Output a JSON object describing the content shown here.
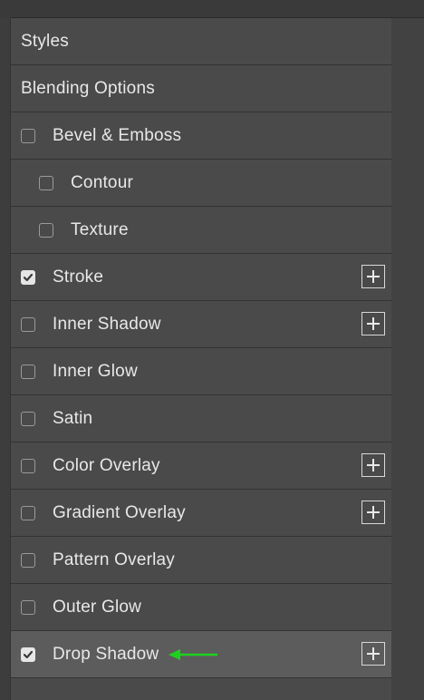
{
  "panel": {
    "headers": [
      {
        "label": "Styles"
      },
      {
        "label": "Blending Options"
      }
    ],
    "effects": [
      {
        "label": "Bevel & Emboss",
        "checked": false,
        "indent": false,
        "has_add": false
      },
      {
        "label": "Contour",
        "checked": false,
        "indent": true,
        "has_add": false
      },
      {
        "label": "Texture",
        "checked": false,
        "indent": true,
        "has_add": false
      },
      {
        "label": "Stroke",
        "checked": true,
        "indent": false,
        "has_add": true
      },
      {
        "label": "Inner Shadow",
        "checked": false,
        "indent": false,
        "has_add": true
      },
      {
        "label": "Inner Glow",
        "checked": false,
        "indent": false,
        "has_add": false
      },
      {
        "label": "Satin",
        "checked": false,
        "indent": false,
        "has_add": false
      },
      {
        "label": "Color Overlay",
        "checked": false,
        "indent": false,
        "has_add": true
      },
      {
        "label": "Gradient Overlay",
        "checked": false,
        "indent": false,
        "has_add": true
      },
      {
        "label": "Pattern Overlay",
        "checked": false,
        "indent": false,
        "has_add": false
      },
      {
        "label": "Outer Glow",
        "checked": false,
        "indent": false,
        "has_add": false
      },
      {
        "label": "Drop Shadow",
        "checked": true,
        "indent": false,
        "has_add": true,
        "selected": true
      }
    ]
  },
  "icons": {
    "checkmark": "checkmark-icon",
    "add": "plus-square-icon",
    "annotation": "green-arrow-icon"
  },
  "colors": {
    "panel_bg": "#4a4a4a",
    "selected_row_bg": "#5c5c5c",
    "annotation_arrow": "#1fd11f"
  }
}
